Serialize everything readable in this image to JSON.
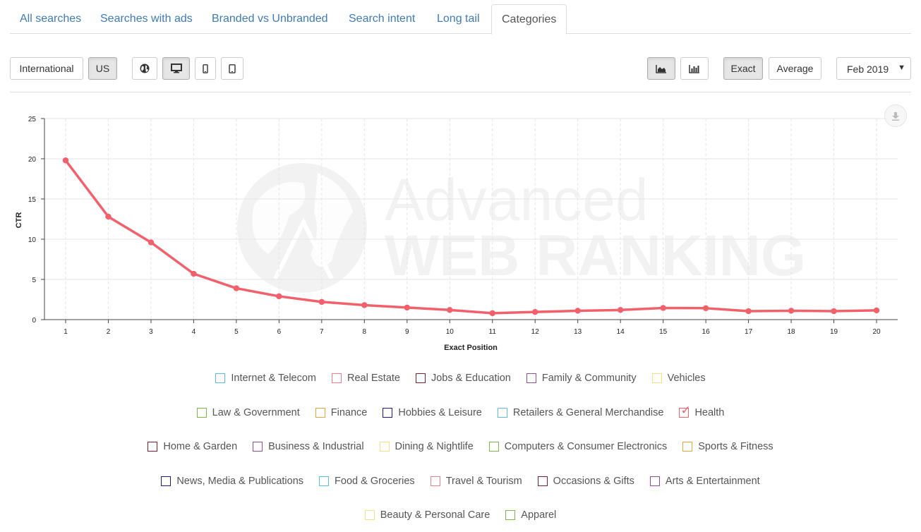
{
  "tabs": [
    {
      "label": "All searches"
    },
    {
      "label": "Searches with ads"
    },
    {
      "label": "Branded vs Unbranded"
    },
    {
      "label": "Search intent"
    },
    {
      "label": "Long tail"
    },
    {
      "label": "Categories",
      "active": true
    }
  ],
  "toolbar": {
    "international_label": "International",
    "us_label": "US",
    "exact_label": "Exact",
    "average_label": "Average",
    "date_value": "Feb 2019",
    "icons": [
      "globe-icon",
      "desktop-icon",
      "mobile-icon",
      "tablet-icon",
      "area-chart-icon",
      "bar-chart-icon",
      "download-icon"
    ]
  },
  "watermark": {
    "line1": "Advanced",
    "line2": "WEB RANKING"
  },
  "chart_data": {
    "type": "line",
    "xlabel": "Exact Position",
    "ylabel": "CTR",
    "x": [
      1,
      2,
      3,
      4,
      5,
      6,
      7,
      8,
      9,
      10,
      11,
      12,
      13,
      14,
      15,
      16,
      17,
      18,
      19,
      20
    ],
    "series": [
      {
        "name": "Health",
        "color": "#f2616b",
        "values": [
          19.8,
          12.8,
          9.6,
          5.7,
          3.9,
          2.9,
          2.2,
          1.8,
          1.5,
          1.2,
          0.8,
          0.95,
          1.1,
          1.2,
          1.45,
          1.42,
          1.05,
          1.1,
          1.05,
          1.15
        ]
      }
    ],
    "ylim": [
      0,
      25
    ],
    "yticks": [
      0,
      5,
      10,
      15,
      20,
      25
    ],
    "grid": true
  },
  "legend": [
    [
      {
        "label": "Internet & Telecom",
        "color": "#5bc0de"
      },
      {
        "label": "Real Estate",
        "color": "#e9808a"
      },
      {
        "label": "Jobs & Education",
        "color": "#7a1f2b"
      },
      {
        "label": "Family & Community",
        "color": "#8e4d96"
      },
      {
        "label": "Vehicles",
        "color": "#f5e08a"
      }
    ],
    [
      {
        "label": "Law & Government",
        "color": "#7ab648"
      },
      {
        "label": "Finance",
        "color": "#e8a53a"
      },
      {
        "label": "Hobbies & Leisure",
        "color": "#1a1a8c"
      },
      {
        "label": "Retailers & General Merchandise",
        "color": "#5bc0de"
      },
      {
        "label": "Health",
        "color": "#f2616b",
        "checked": true
      }
    ],
    [
      {
        "label": "Home & Garden",
        "color": "#7a1f2b"
      },
      {
        "label": "Business & Industrial",
        "color": "#8e4d96"
      },
      {
        "label": "Dining & Nightlife",
        "color": "#f5e08a"
      },
      {
        "label": "Computers & Consumer Electronics",
        "color": "#7ab648"
      },
      {
        "label": "Sports & Fitness",
        "color": "#e8a53a"
      }
    ],
    [
      {
        "label": "News, Media & Publications",
        "color": "#1a1a8c"
      },
      {
        "label": "Food & Groceries",
        "color": "#5bc0de"
      },
      {
        "label": "Travel & Tourism",
        "color": "#e9808a"
      },
      {
        "label": "Occasions & Gifts",
        "color": "#7a1f2b"
      },
      {
        "label": "Arts & Entertainment",
        "color": "#8e4d96"
      }
    ],
    [
      {
        "label": "Beauty & Personal Care",
        "color": "#f5e08a"
      },
      {
        "label": "Apparel",
        "color": "#7ab648"
      }
    ]
  ]
}
